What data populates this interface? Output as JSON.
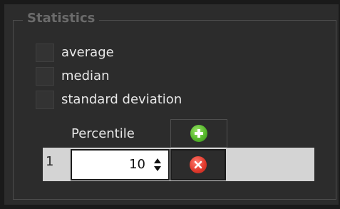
{
  "statistics": {
    "title": "Statistics",
    "options": [
      {
        "label": "average",
        "checked": false
      },
      {
        "label": "median",
        "checked": false
      },
      {
        "label": "standard deviation",
        "checked": false
      }
    ]
  },
  "percentile": {
    "header": "Percentile",
    "add_icon": "plus-circle-icon",
    "rows": [
      {
        "index": "1",
        "value": "10",
        "delete_icon": "close-circle-icon"
      }
    ]
  },
  "colors": {
    "background": "#2c2c2c",
    "text": "#e8e8e8",
    "add": "#56b82c",
    "delete": "#e23b2e"
  }
}
